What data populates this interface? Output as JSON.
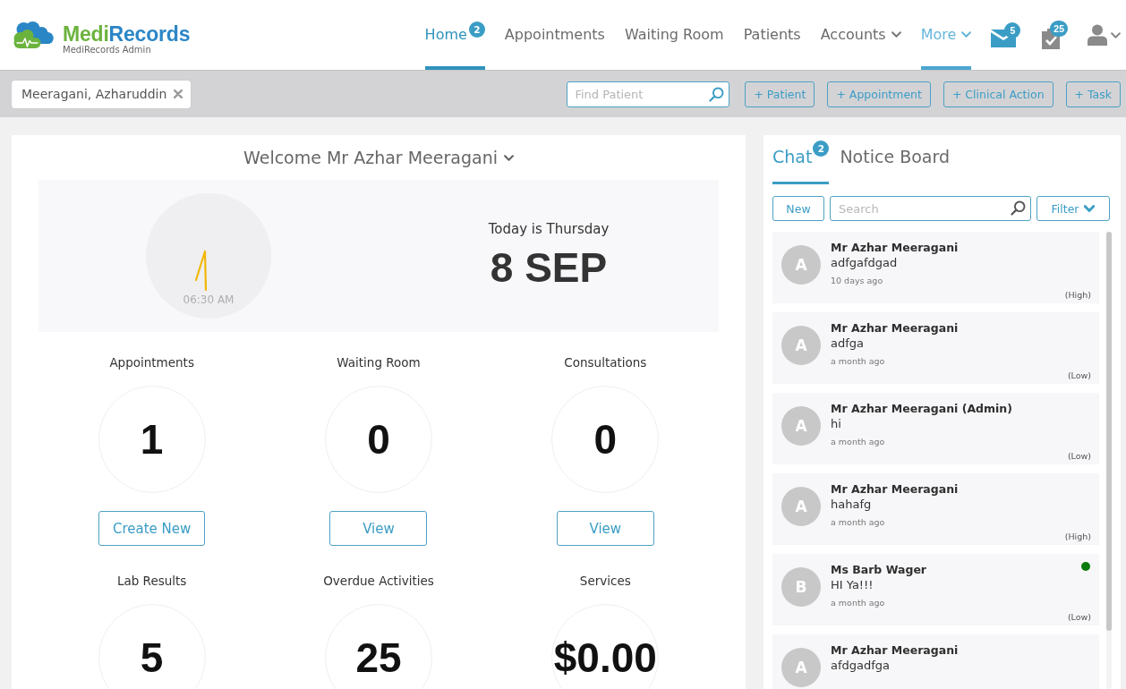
{
  "header": {
    "logo": {
      "wordmark": [
        {
          "text": "Medi",
          "color": "#6cb33e"
        },
        {
          "text": "Records",
          "color": "#2b86c6"
        }
      ],
      "subtitle": "MediRecords Admin"
    },
    "nav": [
      {
        "label": "Home",
        "selected": true,
        "hovered": false,
        "badge": "2",
        "has_menu": false
      },
      {
        "label": "Appointments",
        "selected": false,
        "hovered": false,
        "has_menu": false
      },
      {
        "label": "Waiting Room",
        "selected": false,
        "hovered": false,
        "has_menu": false
      },
      {
        "label": "Patients",
        "selected": false,
        "hovered": false,
        "has_menu": false
      },
      {
        "label": "Accounts",
        "selected": false,
        "hovered": false,
        "has_menu": true
      },
      {
        "label": "More",
        "selected": false,
        "hovered": true,
        "has_menu": true
      }
    ],
    "actions": [
      {
        "kind": "mail",
        "badge": "5",
        "has_menu": false
      },
      {
        "kind": "tasks",
        "badge": "25",
        "has_menu": false
      },
      {
        "kind": "user",
        "has_menu": true
      }
    ]
  },
  "toolbar": {
    "patient_tag": "Meeragani, Azharuddin",
    "patient_search": {
      "placeholder": "Find Patient"
    },
    "buttons": [
      "+ Patient",
      "+ Appointment",
      "+ Clinical Action",
      "+ Task"
    ]
  },
  "dashboard": {
    "greeting": {
      "text": "Welcome Mr Azhar Meeragani",
      "has_menu": true
    },
    "clock": {
      "time": "06:30 AM"
    },
    "today": {
      "weekday": "Today is Thursday",
      "date": "8 SEP"
    },
    "stats": [
      {
        "label": "Appointments",
        "value": "1",
        "action": "Create New"
      },
      {
        "label": "Waiting Room",
        "value": "0",
        "action": "View"
      },
      {
        "label": "Consultations",
        "value": "0",
        "action": "View"
      },
      {
        "label": "Lab Results",
        "value": "5"
      },
      {
        "label": "Overdue Activities",
        "value": "25"
      },
      {
        "label": "Services",
        "value": "$0.00"
      }
    ]
  },
  "chat_panel": {
    "tabs": [
      {
        "label": "Chat",
        "selected": true,
        "badge": "2"
      },
      {
        "label": "Notice Board",
        "selected": false
      }
    ],
    "new_button": "New",
    "search": {
      "placeholder": "Search"
    },
    "filter_button": "Filter",
    "messages": [
      {
        "initial": "A",
        "sender": "Mr Azhar Meeragani",
        "text": "adfgafdgad",
        "time": "10 days ago",
        "priority": "(High)",
        "online": false
      },
      {
        "initial": "A",
        "sender": "Mr Azhar Meeragani",
        "text": "adfga",
        "time": "a month ago",
        "priority": "(Low)",
        "online": false
      },
      {
        "initial": "A",
        "sender": "Mr Azhar Meeragani (Admin)",
        "text": "hi",
        "time": "a month ago",
        "priority": "(Low)",
        "online": false
      },
      {
        "initial": "A",
        "sender": "Mr Azhar Meeragani",
        "text": "hahafg",
        "time": "a month ago",
        "priority": "(High)",
        "online": false
      },
      {
        "initial": "B",
        "sender": "Ms Barb Wager",
        "text": "HI Ya!!!",
        "time": "a month ago",
        "priority": "(Low)",
        "online": true
      },
      {
        "initial": "A",
        "sender": "Mr Azhar Meeragani",
        "text": "afdgadfga",
        "online": false
      }
    ]
  }
}
